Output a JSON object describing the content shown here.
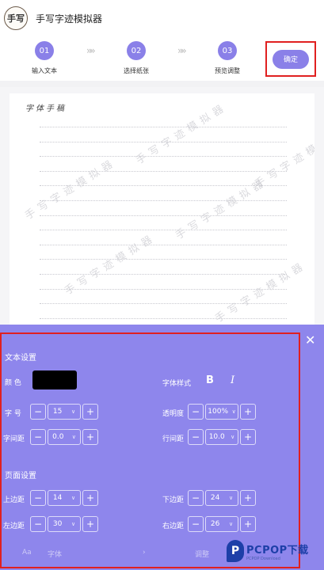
{
  "header": {
    "logo_text": "手写",
    "title": "手写字迹模拟器"
  },
  "steps": [
    {
      "num": "01",
      "label": "输入文本"
    },
    {
      "num": "02",
      "label": "选择纸张"
    },
    {
      "num": "03",
      "label": "预览调整"
    }
  ],
  "step_separator": "»",
  "confirm_label": "确定",
  "paper": {
    "handwriting": "字体手稿",
    "watermark": "手写字迹模拟器",
    "line_count": 16
  },
  "panel": {
    "close_glyph": "✕",
    "text_section": "文本设置",
    "color_label": "颜 色",
    "color_value": "#000000",
    "font_style_label": "字体样式",
    "bold_glyph": "B",
    "italic_glyph": "I",
    "font_size_label": "字 号",
    "font_size_value": "15",
    "opacity_label": "透明度",
    "opacity_value": "100%",
    "char_spacing_label": "字间距",
    "char_spacing_value": "0.0",
    "line_spacing_label": "行间距",
    "line_spacing_value": "10.0",
    "page_section": "页面设置",
    "top_margin_label": "上边距",
    "top_margin_value": "14",
    "bottom_margin_label": "下边距",
    "bottom_margin_value": "24",
    "left_margin_label": "左边距",
    "left_margin_value": "30",
    "right_margin_label": "右边距",
    "right_margin_value": "26",
    "minus": "−",
    "plus": "+",
    "caret": "∨"
  },
  "bottom_bar": {
    "font_icon": "Aa",
    "font_label": "字体",
    "arrow": "›",
    "adjust_label": "调整"
  },
  "brand": {
    "letter": "P",
    "name": "PCPOP下载",
    "sub": "PCPOP Download"
  },
  "colors": {
    "accent": "#8a80e8",
    "panel": "#8e86ec",
    "highlight": "#e02020"
  }
}
